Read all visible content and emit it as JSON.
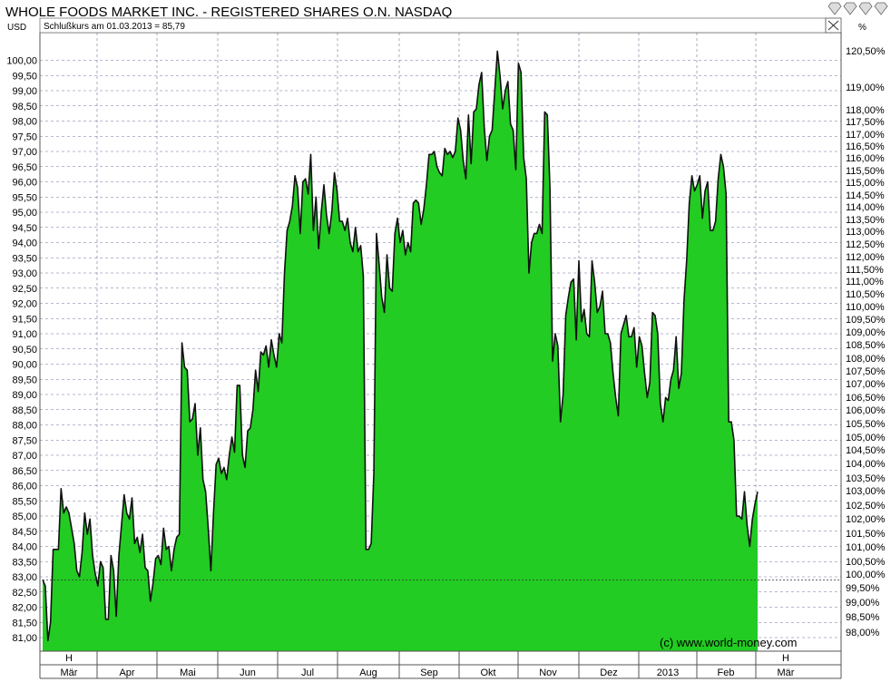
{
  "chart_data": {
    "type": "area",
    "title": "WHOLE FOODS MARKET INC. - REGISTERED SHARES O.N. NASDAQ",
    "subtitle": "Schlußkurs am 01.03.2013 = 85,79",
    "currency_label": "USD",
    "percent_label": "%",
    "watermark": "(c) www.world-money.com",
    "logo": "world-money diamond logo",
    "colors": {
      "fill": "#22cc22",
      "line": "#111111",
      "grid": "#7070a0",
      "background": "#ffffff"
    },
    "grid": true,
    "legend": "none",
    "ylim": [
      80.6,
      100.8
    ],
    "y_ticks": [
      "81,00",
      "81,50",
      "82,00",
      "82,50",
      "83,00",
      "83,50",
      "84,00",
      "84,50",
      "85,00",
      "85,50",
      "86,00",
      "86,50",
      "87,00",
      "87,50",
      "88,00",
      "88,50",
      "89,00",
      "89,50",
      "90,00",
      "90,50",
      "91,00",
      "91,50",
      "92,00",
      "92,50",
      "93,00",
      "93,50",
      "94,00",
      "94,50",
      "95,00",
      "95,50",
      "96,00",
      "96,50",
      "97,00",
      "97,50",
      "98,00",
      "98,50",
      "99,00",
      "99,50",
      "100,00"
    ],
    "pct_ticks": [
      "98,00%",
      "98,50%",
      "99,00%",
      "99,50%",
      "100,00%",
      "100,50%",
      "101,00%",
      "101,50%",
      "102,00%",
      "102,50%",
      "103,00%",
      "103,50%",
      "104,00%",
      "104,50%",
      "105,00%",
      "105,50%",
      "106,00%",
      "106,50%",
      "107,00%",
      "107,50%",
      "108,00%",
      "108,50%",
      "109,00%",
      "109,50%",
      "110,00%",
      "110,50%",
      "111,00%",
      "111,50%",
      "112,00%",
      "112,50%",
      "113,00%",
      "113,50%",
      "114,00%",
      "114,50%",
      "115,00%",
      "115,50%",
      "116,00%",
      "116,50%",
      "117,00%",
      "117,50%",
      "118,00%",
      "119,00%",
      "120,50%"
    ],
    "reference_level_label": "100,00%",
    "x_months": [
      "Mär",
      "Apr",
      "Mai",
      "Jun",
      "Jul",
      "Aug",
      "Sep",
      "Okt",
      "Nov",
      "Dez",
      "2013",
      "Feb",
      "Mär"
    ],
    "x_markers": [
      "H",
      "H"
    ],
    "x_unit": "trading days (1 Mar 2012 – 1 Mar 2013)",
    "series": [
      {
        "values": [
          82.9,
          82.7,
          80.9,
          81.5,
          83.9,
          83.9,
          83.9,
          85.9,
          85.1,
          85.3,
          85.1,
          84.6,
          84.1,
          83.2,
          83.0,
          83.8,
          85.1,
          84.4,
          84.9,
          83.7,
          83.1,
          82.7,
          83.5,
          83.3,
          81.6,
          81.6,
          83.7,
          83.2,
          81.7,
          83.7,
          84.7,
          85.7,
          85.1,
          84.9,
          85.6,
          84.1,
          84.3,
          83.8,
          84.4,
          83.3,
          83.2,
          82.2,
          82.8,
          83.6,
          83.7,
          83.4,
          84.6,
          83.9,
          84.0,
          83.2,
          83.9,
          84.3,
          84.4,
          90.7,
          89.9,
          89.8,
          88.1,
          88.2,
          88.7,
          87.0,
          87.9,
          86.2,
          85.8,
          84.6,
          83.2,
          85.1,
          86.7,
          86.9,
          86.4,
          86.6,
          86.2,
          87.0,
          87.6,
          87.1,
          89.3,
          89.3,
          87.0,
          86.6,
          87.8,
          87.9,
          88.5,
          89.8,
          89.1,
          90.4,
          90.3,
          90.6,
          89.9,
          90.8,
          90.3,
          89.9,
          91.0,
          90.7,
          93.0,
          94.4,
          94.7,
          95.2,
          96.2,
          95.8,
          94.3,
          96.0,
          96.1,
          95.6,
          96.9,
          94.4,
          95.5,
          93.8,
          95.0,
          95.9,
          94.9,
          94.3,
          95.0,
          96.3,
          95.7,
          94.7,
          94.7,
          94.4,
          94.8,
          94.0,
          93.7,
          94.5,
          93.7,
          93.9,
          92.9,
          83.9,
          83.9,
          84.1,
          86.4,
          94.3,
          93.3,
          92.2,
          91.7,
          93.6,
          92.5,
          92.4,
          94.3,
          94.8,
          94.0,
          94.4,
          93.6,
          94.0,
          93.7,
          95.3,
          95.4,
          95.3,
          94.6,
          95.1,
          95.9,
          96.9,
          96.9,
          97.0,
          96.5,
          96.3,
          96.2,
          97.1,
          96.9,
          97.0,
          96.8,
          97.0,
          98.1,
          97.7,
          96.7,
          96.1,
          98.2,
          96.6,
          98.3,
          98.4,
          99.2,
          99.6,
          97.8,
          96.7,
          97.5,
          97.7,
          99.0,
          100.3,
          99.5,
          98.4,
          99.0,
          99.3,
          97.9,
          97.7,
          96.4,
          99.9,
          99.6,
          96.8,
          96.1,
          93.0,
          94.0,
          94.3,
          94.3,
          94.6,
          94.3,
          98.3,
          98.2,
          95.8,
          90.1,
          91.0,
          90.6,
          88.1,
          89.0,
          91.6,
          92.2,
          92.7,
          92.8,
          90.8,
          93.4,
          91.4,
          91.8,
          91.0,
          90.9,
          93.4,
          92.7,
          91.7,
          91.9,
          92.4,
          91.0,
          91.0,
          90.7,
          89.7,
          88.9,
          88.3,
          91.0,
          91.3,
          91.6,
          90.9,
          90.9,
          91.2,
          89.9,
          90.9,
          90.6,
          89.7,
          88.9,
          89.4,
          91.7,
          91.6,
          91.0,
          88.7,
          88.1,
          88.9,
          88.8,
          89.5,
          89.8,
          90.9,
          89.2,
          89.7,
          92.1,
          93.4,
          95.3,
          96.2,
          95.7,
          95.9,
          96.2,
          94.8,
          95.7,
          96.0,
          94.4,
          94.4,
          94.7,
          96.1,
          96.9,
          96.5,
          95.6,
          88.1,
          88.1,
          87.5,
          85.0,
          85.0,
          84.9,
          85.8,
          84.7,
          84.0,
          84.9,
          85.4,
          85.8
        ]
      }
    ]
  }
}
